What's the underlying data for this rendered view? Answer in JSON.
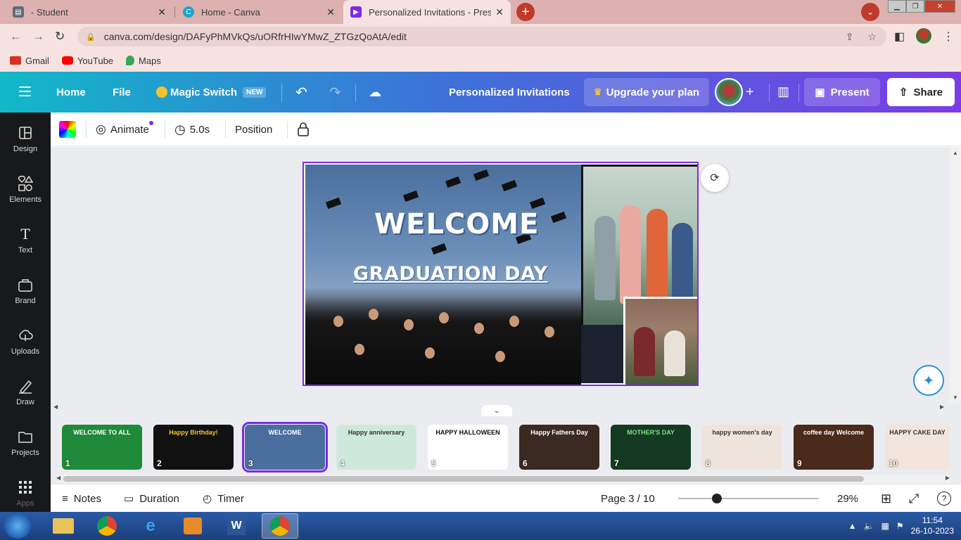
{
  "browser": {
    "tabs": [
      {
        "label": "- Student",
        "favicon": "doc-icon",
        "active": false
      },
      {
        "label": "Home - Canva",
        "favicon": "canva-icon",
        "active": false
      },
      {
        "label": "Personalized Invitations - Present",
        "favicon": "canva-present-icon",
        "active": true
      }
    ],
    "url": "canva.com/design/DAFyPhMVkQs/uORfrHIwYMwZ_ZTGzQoAtA/edit",
    "bookmarks": [
      {
        "label": "Gmail",
        "icon": "gmail-icon",
        "color": "#d93025"
      },
      {
        "label": "YouTube",
        "icon": "youtube-icon",
        "color": "#ff0000"
      },
      {
        "label": "Maps",
        "icon": "maps-icon",
        "color": "#34a853"
      }
    ]
  },
  "header": {
    "home": "Home",
    "file": "File",
    "magic_switch": "Magic Switch",
    "new_badge": "NEW",
    "doc_title": "Personalized Invitations",
    "upgrade": "Upgrade your plan",
    "present": "Present",
    "share": "Share"
  },
  "sidebar": {
    "items": [
      {
        "label": "Design",
        "icon": "design-icon"
      },
      {
        "label": "Elements",
        "icon": "elements-icon"
      },
      {
        "label": "Text",
        "icon": "text-icon"
      },
      {
        "label": "Brand",
        "icon": "brand-icon"
      },
      {
        "label": "Uploads",
        "icon": "uploads-icon"
      },
      {
        "label": "Draw",
        "icon": "draw-icon"
      },
      {
        "label": "Projects",
        "icon": "projects-icon"
      },
      {
        "label": "Apps",
        "icon": "apps-icon"
      }
    ]
  },
  "toolbar": {
    "animate": "Animate",
    "duration": "5.0s",
    "position": "Position"
  },
  "slide": {
    "welcome": "WELCOME",
    "subtitle": "GRADUATION DAY"
  },
  "pages": [
    {
      "num": "1",
      "title": "WELCOME TO ALL",
      "bg": "#1f8a3a",
      "color": "#fff"
    },
    {
      "num": "2",
      "title": "Happy Birthday!",
      "bg": "#111111",
      "color": "#f4c430"
    },
    {
      "num": "3",
      "title": "WELCOME",
      "bg": "#4a6f9e",
      "color": "#fff",
      "selected": true
    },
    {
      "num": "4",
      "title": "Happy anniversary",
      "bg": "#cfe8dc",
      "color": "#333"
    },
    {
      "num": "5",
      "title": "HAPPY HALLOWEEN",
      "bg": "#ffffff",
      "color": "#111"
    },
    {
      "num": "6",
      "title": "Happy Fathers Day",
      "bg": "#3a2a22",
      "color": "#fff"
    },
    {
      "num": "7",
      "title": "MOTHER'S DAY",
      "bg": "#143a22",
      "color": "#7ee08a"
    },
    {
      "num": "8",
      "title": "happy women's day",
      "bg": "#efe4dc",
      "color": "#333"
    },
    {
      "num": "9",
      "title": "coffee day Welcome",
      "bg": "#4a2a1a",
      "color": "#fff"
    },
    {
      "num": "10",
      "title": "HAPPY CAKE DAY",
      "bg": "#f2e6dc",
      "color": "#333"
    }
  ],
  "footer": {
    "notes": "Notes",
    "duration": "Duration",
    "timer": "Timer",
    "page_indicator": "Page 3 / 10",
    "zoom": "29%",
    "zoom_level": 0.29
  },
  "taskbar": {
    "time": "11:54",
    "date": "26-10-2023"
  }
}
